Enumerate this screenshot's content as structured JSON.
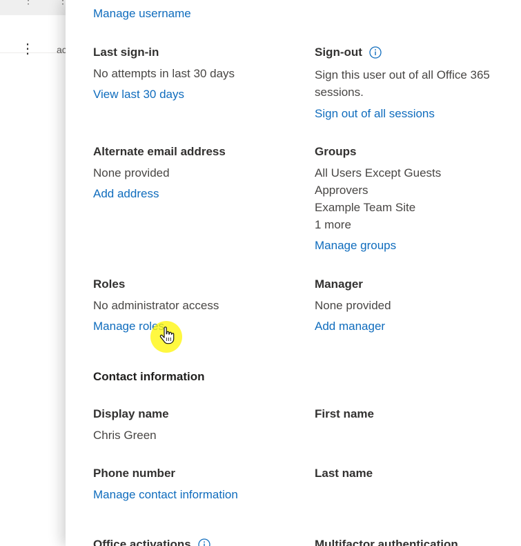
{
  "background": {
    "row_text": "ac"
  },
  "panel": {
    "manage_username": "Manage username",
    "last_signin": {
      "label": "Last sign-in",
      "value": "No attempts in last 30 days",
      "link": "View last 30 days"
    },
    "signout": {
      "label": "Sign-out",
      "value_line1": "Sign this user out of all Office 365",
      "value_line2": "sessions.",
      "link": "Sign out of all sessions"
    },
    "alternate_email": {
      "label": "Alternate email address",
      "value": "None provided",
      "link": "Add address"
    },
    "groups": {
      "label": "Groups",
      "items": [
        "All Users Except Guests",
        "Approvers",
        "Example Team Site",
        "1 more"
      ],
      "link": "Manage groups"
    },
    "roles": {
      "label": "Roles",
      "value": "No administrator access",
      "link": "Manage roles"
    },
    "manager": {
      "label": "Manager",
      "value": "None provided",
      "link": "Add manager"
    },
    "contact_heading": "Contact information",
    "display_name": {
      "label": "Display name",
      "value": "Chris Green"
    },
    "first_name": {
      "label": "First name"
    },
    "phone_number": {
      "label": "Phone number",
      "link": "Manage contact information"
    },
    "last_name": {
      "label": "Last name"
    },
    "office_activations": {
      "label": "Office activations"
    },
    "mfa": {
      "label": "Multifactor authentication"
    }
  },
  "colors": {
    "link": "#0f6cbd",
    "label": "#323130",
    "value": "#484644",
    "cursor_highlight": "#fff500"
  },
  "icons": [
    "more-vertical-icon",
    "info-icon",
    "hand-pointer-icon"
  ]
}
